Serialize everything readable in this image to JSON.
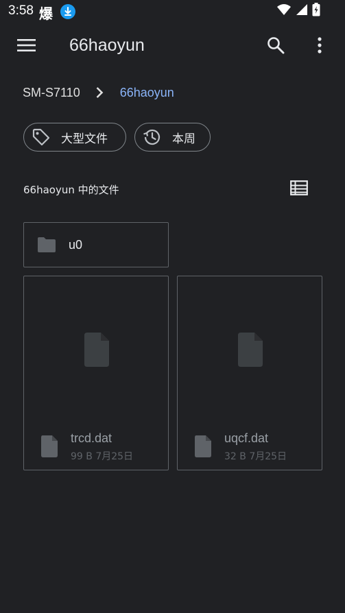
{
  "status_bar": {
    "time": "3:58",
    "app_glyph": "爆",
    "icons": [
      "download-icon",
      "wifi-icon",
      "signal-icon",
      "battery-charging-icon"
    ]
  },
  "app_bar": {
    "title": "66haoyun",
    "icons": [
      "menu-icon",
      "search-icon",
      "more-vert-icon"
    ]
  },
  "breadcrumb": {
    "root": "SM-S7110",
    "current": "66haoyun",
    "separator_icon": "chevron-right-icon"
  },
  "chips": [
    {
      "label": "大型文件",
      "icon": "tag-icon"
    },
    {
      "label": "本周",
      "icon": "history-icon"
    }
  ],
  "section": {
    "title": "66haoyun 中的文件",
    "view_toggle_icon": "list-view-icon"
  },
  "folders": [
    {
      "name": "u0",
      "icon": "folder-icon"
    }
  ],
  "files": [
    {
      "name": "trcd.dat",
      "size": "99 B",
      "date": "7月25日",
      "icon": "file-icon"
    },
    {
      "name": "uqcf.dat",
      "size": "32 B",
      "date": "7月25日",
      "icon": "file-icon"
    }
  ],
  "colors": {
    "background": "#202124",
    "accent": "#8ab4f8",
    "text_primary": "#e8eaed",
    "card_border": "#5f6368",
    "download_badge": "#1a9bf0"
  }
}
